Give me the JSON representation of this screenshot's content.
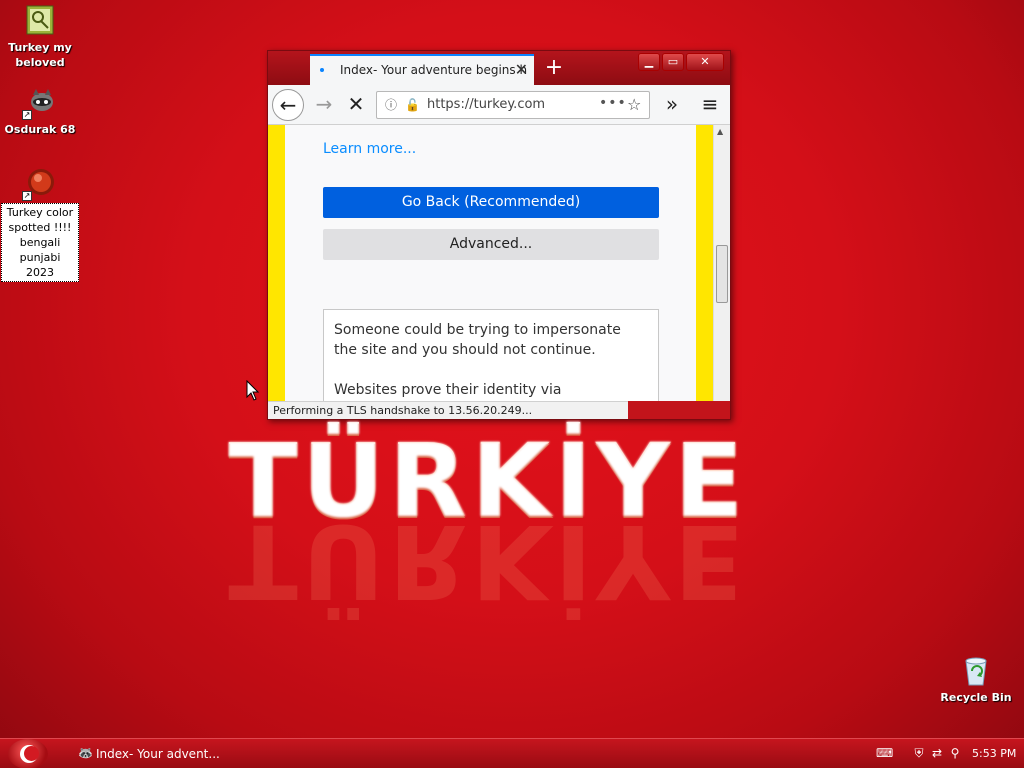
{
  "desktop": {
    "icons": [
      {
        "label": "Turkey my beloved"
      },
      {
        "label": "Osdurak 68"
      },
      {
        "label": "Turkey color spotted !!!! bengali punjabi 2023"
      },
      {
        "label": "Recycle Bin"
      }
    ],
    "wallpaper_text": "TÜRKİYE"
  },
  "browser": {
    "tab_title": "Index- Your adventure begins h",
    "url": "https://turkey.com",
    "page": {
      "learn_more": "Learn more...",
      "go_back_label": "Go Back (Recommended)",
      "advanced_label": "Advanced...",
      "details_p1": "Someone could be trying to impersonate the site and you should not continue.",
      "details_p2": "Websites prove their identity via certificates."
    },
    "status": "Performing a TLS handshake to 13.56.20.249..."
  },
  "taskbar": {
    "task_label": "Index- Your advent...",
    "clock": "5:53 PM"
  },
  "colors": {
    "desktop_red": "#d40f18",
    "warning_yellow": "#ffe600",
    "primary_blue": "#0060df",
    "link_blue": "#0a8dff"
  }
}
